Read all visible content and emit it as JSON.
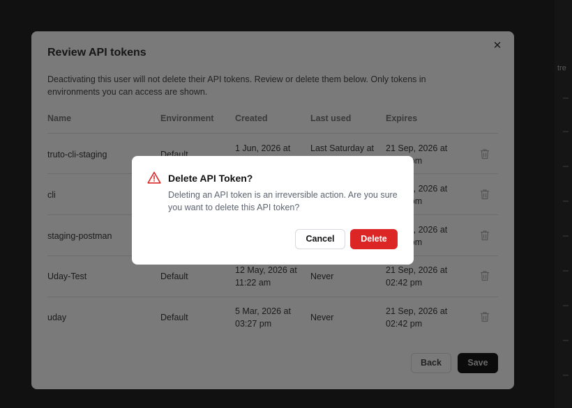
{
  "background": {
    "edge_text": "tre"
  },
  "review_dialog": {
    "title": "Review API tokens",
    "close_icon": "close-icon",
    "description": "Deactivating this user will not delete their API tokens. Review or delete them below. Only tokens in environments you can access are shown.",
    "columns": [
      "Name",
      "Environment",
      "Created",
      "Last used",
      "Expires"
    ],
    "rows": [
      {
        "name": "truto-cli-staging",
        "environment": "Default",
        "created": "1 Jun, 2026 at",
        "last_used": "Last Saturday at",
        "expires": "21 Sep, 2026 at 02:42 pm"
      },
      {
        "name": "cli",
        "environment": "",
        "created": "",
        "last_used": "",
        "expires": "21 Sep, 2026 at 02:42 pm"
      },
      {
        "name": "staging-postman",
        "environment": "",
        "created": "",
        "last_used": "",
        "expires": "21 Sep, 2026 at 02:42 pm"
      },
      {
        "name": "Uday-Test",
        "environment": "Default",
        "created": "12 May, 2026 at 11:22 am",
        "last_used": "Never",
        "expires": "21 Sep, 2026 at 02:42 pm"
      },
      {
        "name": "uday",
        "environment": "Default",
        "created": "5 Mar, 2026 at 03:27 pm",
        "last_used": "Never",
        "expires": "21 Sep, 2026 at 02:42 pm"
      }
    ],
    "back_label": "Back",
    "save_label": "Save"
  },
  "confirm_dialog": {
    "icon": "warning-triangle-icon",
    "title": "Delete API Token?",
    "message": "Deleting an API token is an irreversible action. Are you sure you want to delete this API token?",
    "cancel_label": "Cancel",
    "delete_label": "Delete",
    "colors": {
      "danger": "#dc2626",
      "warning_icon": "#dc2626"
    }
  }
}
